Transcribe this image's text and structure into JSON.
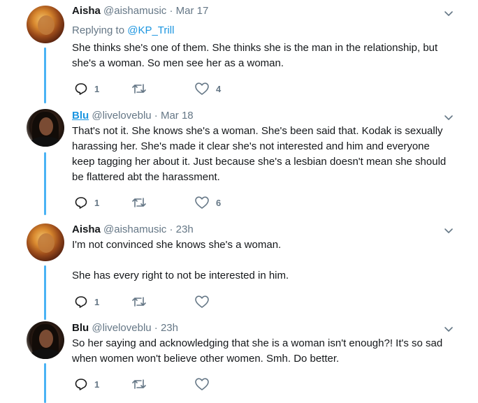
{
  "tweets": [
    {
      "author": "Aisha",
      "handle": "@aishamusic",
      "time": "Mar 17",
      "replying_prefix": "Replying to ",
      "replying_to": "@KP_Trill",
      "lines": [
        "She thinks she's one of them. She thinks she is the man in the relationship, but she's a woman. So men see her as a woman."
      ],
      "reply_count": "1",
      "retweet_count": "",
      "like_count": "4"
    },
    {
      "author": "Blu",
      "handle": "@liveloveblu",
      "time": "Mar 18",
      "lines": [
        "That's not it. She knows she's a woman. She's been said that. Kodak is sexually harassing her. She's made it clear she's not interested and him and everyone keep tagging her about it. Just because she's a lesbian doesn't mean she should be flattered abt the harassment."
      ],
      "reply_count": "1",
      "retweet_count": "",
      "like_count": "6"
    },
    {
      "author": "Aisha",
      "handle": "@aishamusic",
      "time": "23h",
      "lines": [
        "I'm not convinced she knows she's a woman.",
        "She has every right to not be interested in him."
      ],
      "reply_count": "1",
      "retweet_count": "",
      "like_count": ""
    },
    {
      "author": "Blu",
      "handle": "@liveloveblu",
      "time": "23h",
      "lines": [
        "So her saying and acknowledging that she is a woman isn't enough?! It's so sad when women won't believe other women. Smh. Do better."
      ],
      "reply_count": "1",
      "retweet_count": "",
      "like_count": ""
    }
  ],
  "separator": "·",
  "colors": {
    "accent": "#1b95e0",
    "thread_line": "#4ab3f4",
    "muted": "#657786",
    "text": "#14171a"
  },
  "icons": {
    "reply": "reply-icon",
    "retweet": "retweet-icon",
    "like": "heart-icon",
    "menu": "chevron-down-icon"
  }
}
